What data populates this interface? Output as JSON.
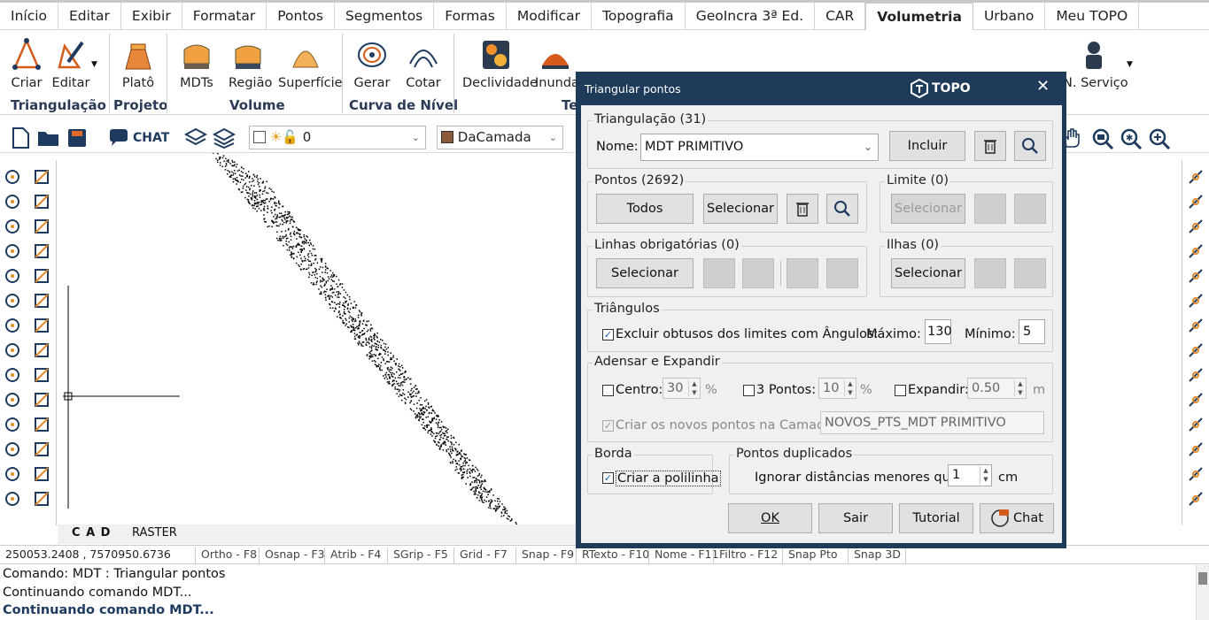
{
  "menu": [
    "Início",
    "Editar",
    "Exibir",
    "Formatar",
    "Pontos",
    "Segmentos",
    "Formas",
    "Modificar",
    "Topografia",
    "GeoIncra 3ª Ed.",
    "CAR",
    "Volumetria",
    "Urbano",
    "Meu TOPO"
  ],
  "active_menu": "Volumetria",
  "ribbon": {
    "buttons": [
      {
        "label": "Criar"
      },
      {
        "label": "Editar"
      },
      {
        "label": "Platô"
      },
      {
        "label": "MDTs"
      },
      {
        "label": "Região"
      },
      {
        "label": "Superfície"
      },
      {
        "label": "Gerar"
      },
      {
        "label": "Cotar"
      },
      {
        "label": "Declividade"
      },
      {
        "label": "Inunda"
      },
      {
        "label": "N. Serviço"
      }
    ],
    "groups": [
      "Triangulação",
      "Projeto",
      "Volume",
      "Curva de Nível",
      "Te"
    ]
  },
  "toolbar": {
    "chat_label": "CHAT",
    "layer_value": "0",
    "color_value": "DaCamada"
  },
  "tabs": {
    "cad": "C A D",
    "raster": "RASTER"
  },
  "status": {
    "coords": "250053.2408 , 7570950.6736",
    "items": [
      "Ortho - F8",
      "Osnap - F3",
      "Atrib - F4",
      "SGrip - F5",
      "Grid - F7",
      "Snap - F9",
      "RTexto - F10",
      "Nome - F11",
      "Filtro - F12",
      "Snap Pto",
      "Snap 3D"
    ]
  },
  "command": {
    "lines": [
      "Comando: MDT : Triangular pontos",
      "Continuando comando MDT..."
    ],
    "current": "Continuando comando MDT..."
  },
  "dialog": {
    "title": "Triangular pontos",
    "logo": "TOPO",
    "triangulacao": {
      "legend": "Triangulação (31)",
      "nome_label": "Nome:",
      "nome_value": "MDT PRIMITIVO",
      "incluir": "Incluir"
    },
    "pontos": {
      "legend": "Pontos (2692)",
      "todos": "Todos",
      "selecionar": "Selecionar"
    },
    "limite": {
      "legend": "Limite (0)",
      "selecionar": "Selecionar"
    },
    "linhas": {
      "legend": "Linhas obrigatórias (0)",
      "selecionar": "Selecionar"
    },
    "ilhas": {
      "legend": "Ilhas (0)",
      "selecionar": "Selecionar"
    },
    "triangulos": {
      "legend": "Triângulos",
      "excluir": "Excluir obtusos dos limites com Ângulos:",
      "maximo_label": "Máximo:",
      "maximo": "130",
      "minimo_label": "Mínimo:",
      "minimo": "5",
      "excluir_checked": true
    },
    "adensar": {
      "legend": "Adensar e Expandir",
      "centro": "Centro:",
      "centro_val": "30",
      "pct1": "%",
      "pontos3": "3 Pontos:",
      "pontos3_val": "10",
      "pct2": "%",
      "expandir": "Expandir:",
      "expandir_val": "0.50",
      "m": "m",
      "criar": "Criar os novos pontos na Camada:",
      "camada": "NOVOS_PTS_MDT PRIMITIVO"
    },
    "borda": {
      "legend": "Borda",
      "criar": "Criar a polilinha",
      "checked": true
    },
    "duplicados": {
      "legend": "Pontos duplicados",
      "ignorar": "Ignorar distâncias menores que:",
      "val": "1",
      "unit": "cm"
    },
    "buttons": {
      "ok": "OK",
      "sair": "Sair",
      "tutorial": "Tutorial",
      "chat": "Chat"
    }
  }
}
